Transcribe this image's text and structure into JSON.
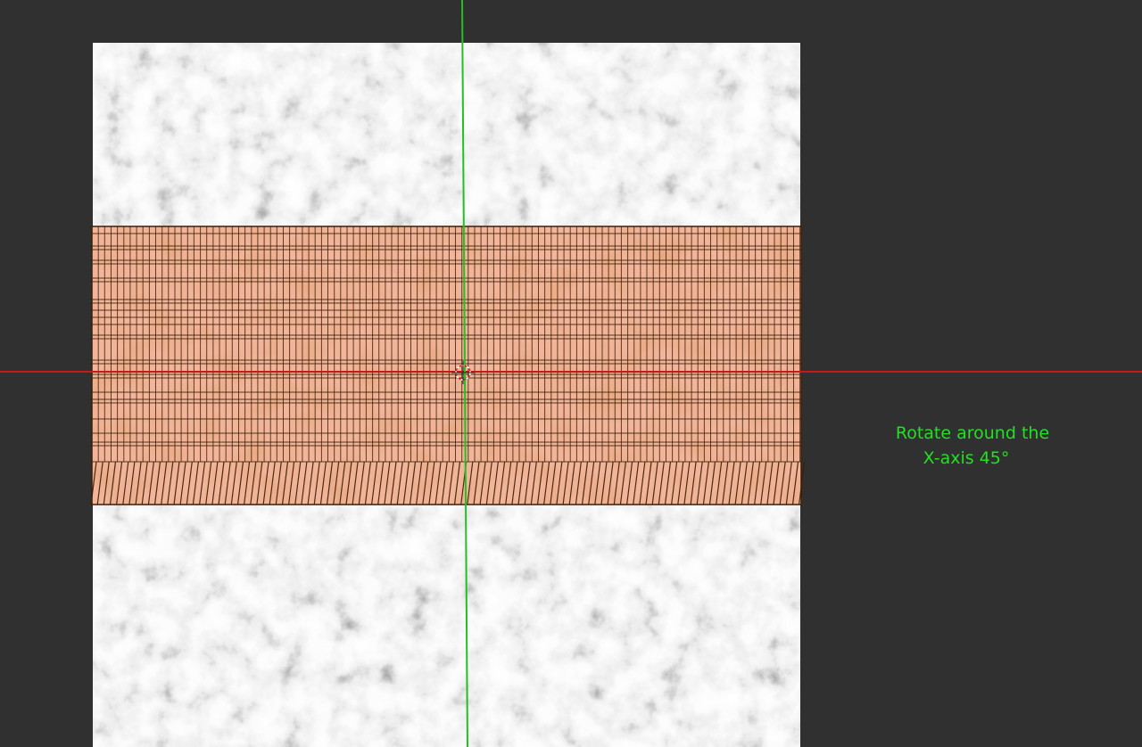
{
  "viewport": {
    "background": "#303030",
    "x_axis_color": "#c41a1a",
    "y_axis_color": "#22c022",
    "texture_name": "granite texture",
    "mesh_name": "orange grid mesh",
    "mesh_fill": "#e89a78",
    "mesh_wire": "#3a1e08",
    "cursor_icon": "3d-cursor-icon"
  },
  "annotation": {
    "line1": "Rotate around the",
    "line2": "X-axis 45°",
    "color": "#22e022"
  }
}
